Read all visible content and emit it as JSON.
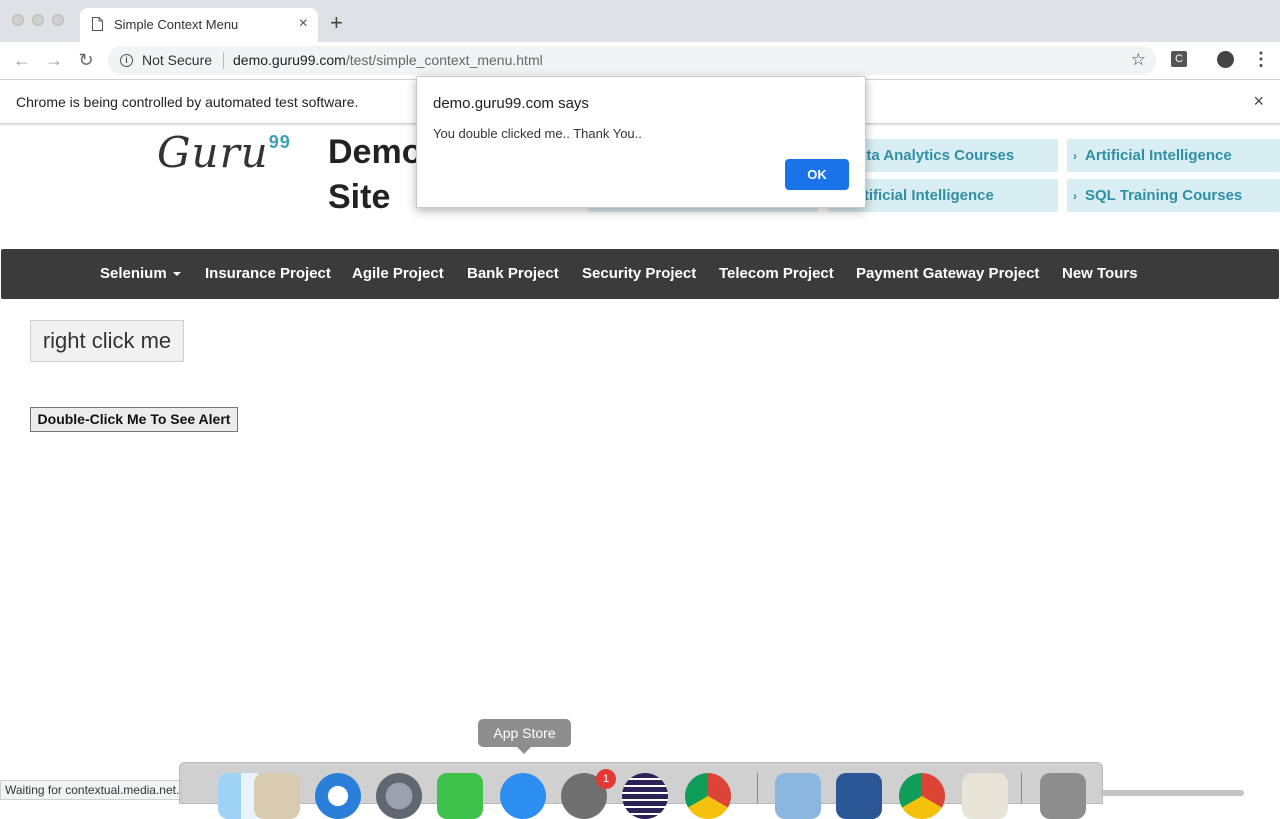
{
  "browser": {
    "tab_title": "Simple Context Menu",
    "tab_close": "×",
    "new_tab": "+",
    "security_label": "Not Secure",
    "url_host": "demo.guru99.com",
    "url_path": "/test/simple_context_menu.html",
    "infobar_text": "Chrome is being controlled by automated test software.",
    "infobar_close": "×",
    "ext_label": "C"
  },
  "page": {
    "logo_text": "Guru",
    "logo_sup": "99",
    "site_title": "Demo Site",
    "courses": [
      "ata Analytics Courses",
      "Artificial Intelligence",
      "rtificial Intelligence",
      "SQL Training Courses"
    ],
    "nav": [
      "Selenium",
      "Insurance Project",
      "Agile Project",
      "Bank Project",
      "Security Project",
      "Telecom Project",
      "Payment Gateway Project",
      "New Tours"
    ],
    "right_click_label": "right click me",
    "double_click_label": "Double-Click Me To See Alert"
  },
  "dialog": {
    "title": "demo.guru99.com says",
    "message": "You double clicked me.. Thank You..",
    "ok_label": "OK"
  },
  "status_text": "Waiting for contextual.media.net...",
  "dock": {
    "tooltip": "App Store",
    "badge_count": "1",
    "apps": [
      "finder-icon",
      "mail-icon",
      "safari-icon",
      "launchpad-icon",
      "facetime-icon",
      "app-store-icon",
      "system-preferences-icon",
      "eclipse-icon",
      "chrome-icon",
      "preview-icon",
      "word-icon",
      "chrome-icon",
      "java-icon",
      "trash-icon"
    ]
  },
  "colors": {
    "nav_bg": "#3b3b3b",
    "course_bg": "#d9eef2",
    "course_text": "#2f8fa3",
    "dialog_ok": "#1a73e8"
  }
}
